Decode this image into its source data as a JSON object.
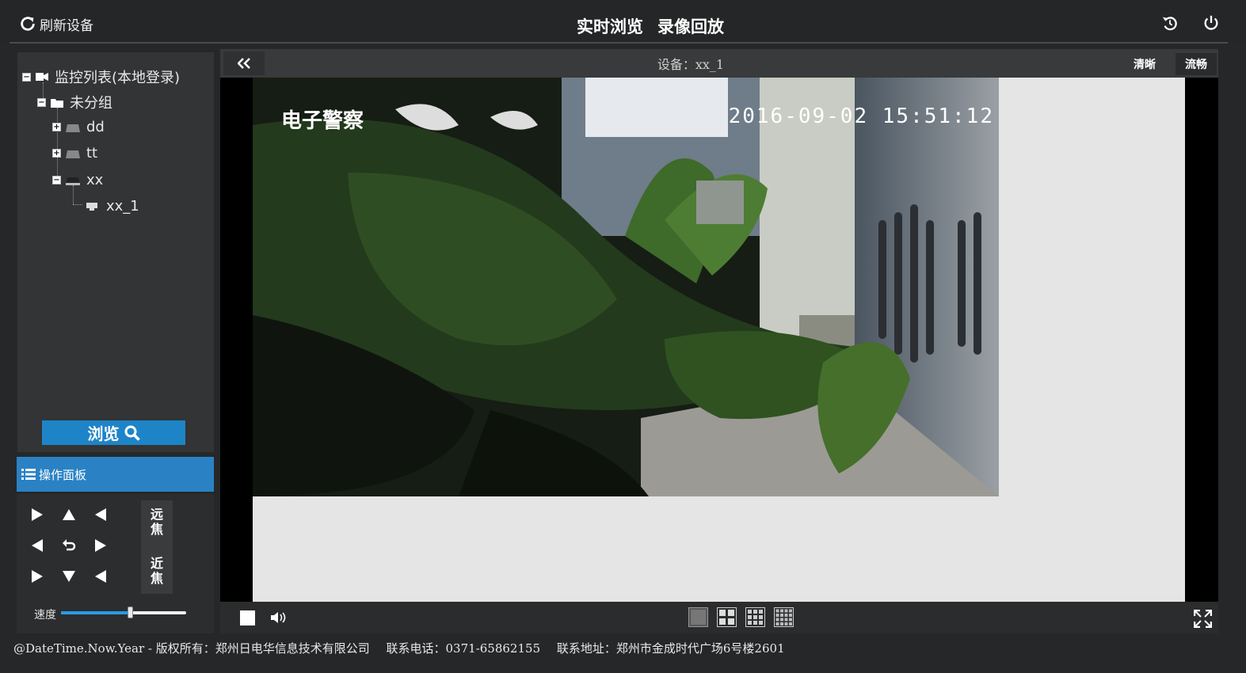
{
  "header": {
    "refresh_label": "刷新设备",
    "tabs": [
      {
        "label": "实时浏览"
      },
      {
        "label": "录像回放"
      }
    ]
  },
  "sidebar": {
    "tree": {
      "root": "监控列表(本地登录)",
      "group": "未分组",
      "nodes": [
        "dd",
        "tt",
        "xx"
      ],
      "child": "xx_1"
    },
    "browse_label": "浏览"
  },
  "operations": {
    "title": "操作面板",
    "focus_far": [
      "远",
      "焦"
    ],
    "focus_near": [
      "近",
      "焦"
    ],
    "speed_label": "速度",
    "speed_value": 0.55
  },
  "player": {
    "device_title": "设备：xx_1",
    "quality_options": [
      "清晰",
      "流畅"
    ],
    "selected_quality": "流畅",
    "osd_title": "电子警察",
    "osd_time": "2016-09-02  15:51:12"
  },
  "footer": {
    "copyright": "@DateTime.Now.Year - 版权所有：郑州日电华信息技术有限公司",
    "phone": "联系电话：0371-65862155",
    "address": "联系地址：郑州市金成时代广场6号楼2601"
  },
  "colors": {
    "accent": "#2a82c4",
    "browse": "#1e84c8",
    "slider_fill": "#2a9be6"
  }
}
